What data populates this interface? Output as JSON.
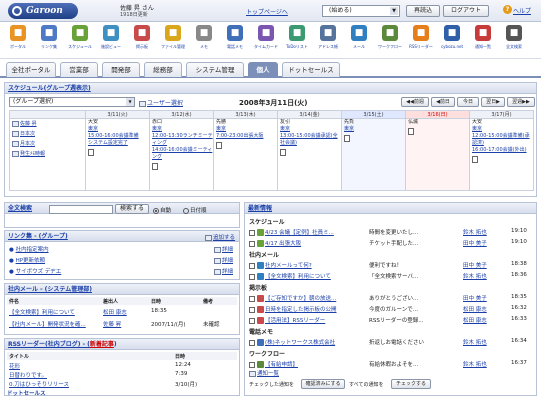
{
  "header": {
    "logo": "Garoon",
    "user_name": "佐藤 昇 さん",
    "user_date": "1918日更新",
    "top_link": "トップページへ",
    "org_select": "(始める)",
    "reload": "再読込",
    "logout": "ログアウト",
    "help": "ヘルプ"
  },
  "apps": [
    {
      "label": "ポータル",
      "icon": "portal-icon",
      "color": "#e89324"
    },
    {
      "label": "リンク集",
      "icon": "link-icon",
      "color": "#4d79c7"
    },
    {
      "label": "スケジュール",
      "icon": "calendar-icon",
      "color": "#6aa23a"
    },
    {
      "label": "施設ビュー",
      "icon": "facility-icon",
      "color": "#3e8fc2"
    },
    {
      "label": "掲示板",
      "icon": "board-icon",
      "color": "#c94a4a"
    },
    {
      "label": "ファイル管理",
      "icon": "folder-icon",
      "color": "#d9a61c"
    },
    {
      "label": "メモ",
      "icon": "memo-icon",
      "color": "#888888"
    },
    {
      "label": "電話メモ",
      "icon": "phone-icon",
      "color": "#3f6fb8"
    },
    {
      "label": "タイムカード",
      "icon": "clock-icon",
      "color": "#7a56b0"
    },
    {
      "label": "ToDoリスト",
      "icon": "todo-icon",
      "color": "#3c9a72"
    },
    {
      "label": "アドレス帳",
      "icon": "address-icon",
      "color": "#55739c"
    },
    {
      "label": "メール",
      "icon": "mail-icon",
      "color": "#2f7fc1"
    },
    {
      "label": "ワークフロー",
      "icon": "workflow-icon",
      "color": "#5b8a3a"
    },
    {
      "label": "RSSリーダー",
      "icon": "rss-icon",
      "color": "#e67e1b"
    },
    {
      "label": "cybozu.net",
      "icon": "cybozu-icon",
      "color": "#2e5fa8"
    },
    {
      "label": "通知一覧",
      "icon": "notice-icon",
      "color": "#c73b3b"
    },
    {
      "label": "全文検索",
      "icon": "search-icon",
      "color": "#555555"
    }
  ],
  "tabs": [
    "全社ポータル",
    "営業部",
    "開発部",
    "総務部",
    "システム管理",
    "個人",
    "ドットセールス"
  ],
  "schedule": {
    "title": "スケジュール(グループ週表示)",
    "group_select": "(グループ選択)",
    "user_search": "ユーザー選択",
    "date": "2008年3月11日(火)",
    "nav": [
      "前週",
      "前日",
      "今日",
      "翌日",
      "翌週"
    ],
    "day_headers": [
      "3/11(火)",
      "3/12(水)",
      "3/13(木)",
      "3/14(金)",
      "3/15(土)",
      "3/16(日)",
      "3/17(月)"
    ],
    "people": [
      "佐藤 昇",
      "日本次",
      "月本次",
      "発生ﾒﾓ時報"
    ],
    "cell_titles": [
      "大安",
      "赤口",
      "先勝",
      "友引",
      "先負",
      "仏滅",
      "大安"
    ],
    "events": [
      [
        "東京",
        "15:00-16:00会議準備",
        "システム設定完了"
      ],
      [
        "東京",
        "12:00-13:30ランチミーティング",
        "14:00-16:00会議ミーティング"
      ],
      [
        "東京",
        "7:00-23:00出張大阪"
      ],
      [
        "東京",
        "13:00-15:00会議承認(全社会議)"
      ],
      [
        "東京"
      ],
      [],
      [
        "東京",
        "12:00-15:00会議準備(承認済)",
        "16:00-17:00会議(外出)"
      ]
    ]
  },
  "search": {
    "title": "全文検索",
    "button": "検索する",
    "opt_auto": "自動",
    "opt_daily": "日付順"
  },
  "links": {
    "title": "リンク集 - (グループ)",
    "add": "追加する",
    "items": [
      "社内指定案内",
      "HP更新依頼",
      "サイボウズ デヂエ"
    ],
    "detail": "詳細"
  },
  "mail": {
    "title": "社内メール - (システム管理部)",
    "headers": [
      "件名",
      "差出人",
      "日時",
      "備考"
    ],
    "rows": [
      [
        "【全文検索】利用について",
        "松田 康志",
        "18:35",
        ""
      ],
      [
        "【社内メール】開発状況を確...",
        "佐藤 昇",
        "2007/11/(月)",
        "未確認"
      ]
    ]
  },
  "rss": {
    "title": "RSSリーダー(社内ブログ) - (",
    "new": "新着記事",
    "headers": [
      "タイトル",
      "日時"
    ],
    "rows": [
      [
        "花形",
        "12:24"
      ],
      [
        "日替わりです。",
        "7:39"
      ],
      [
        "0.刀はひっそりリリース",
        "3/10(月)"
      ]
    ],
    "footer": "ドットセールス"
  },
  "latest": {
    "title": "最新情報",
    "sections": [
      {
        "name": "スケジュール",
        "rows": [
          [
            "4/23 会議【定例】社員ミ...",
            "時間を変更いたし...",
            "鈴木 拓也",
            "19:10"
          ],
          [
            "4/17 出張大阪",
            "チケット手配した...",
            "田中 美子",
            "19:10"
          ]
        ]
      },
      {
        "name": "社内メール",
        "rows": [
          [
            "社内メールって何?",
            "便利ですね！",
            "田中 美子",
            "18:38"
          ],
          [
            "【全文検索】利用について",
            "「全文検索サーバ...",
            "鈴木 拓也",
            "18:36"
          ]
        ]
      },
      {
        "name": "掲示板",
        "rows": [
          [
            "【ご存知ですか】朝の放送...",
            "ありがとうござい...",
            "田中 美子",
            "18:35"
          ],
          [
            "日時を指定した掲示板の公開",
            "今度のガルーンで...",
            "松田 康志",
            "16:32"
          ],
          [
            "【活用法】RSSリーダー",
            "RSSリーダーの登録...",
            "松田 康志",
            "16:33"
          ]
        ]
      },
      {
        "name": "電話メモ",
        "rows": [
          [
            "(株)ネットワークス株式会社",
            "折返しお電話ください",
            "鈴木 拓也",
            "16:34"
          ]
        ]
      },
      {
        "name": "ワークフロー",
        "rows": [
          [
            "【有給申請】",
            "有給休暇およそを...",
            "鈴木 拓也",
            "16:37"
          ]
        ]
      }
    ],
    "notice": "通知一覧",
    "footer_text": "チェックした通知を",
    "confirm_btn": "確認済みにする",
    "footer_text2": "すべての通知を",
    "check_btn": "チェックする"
  }
}
